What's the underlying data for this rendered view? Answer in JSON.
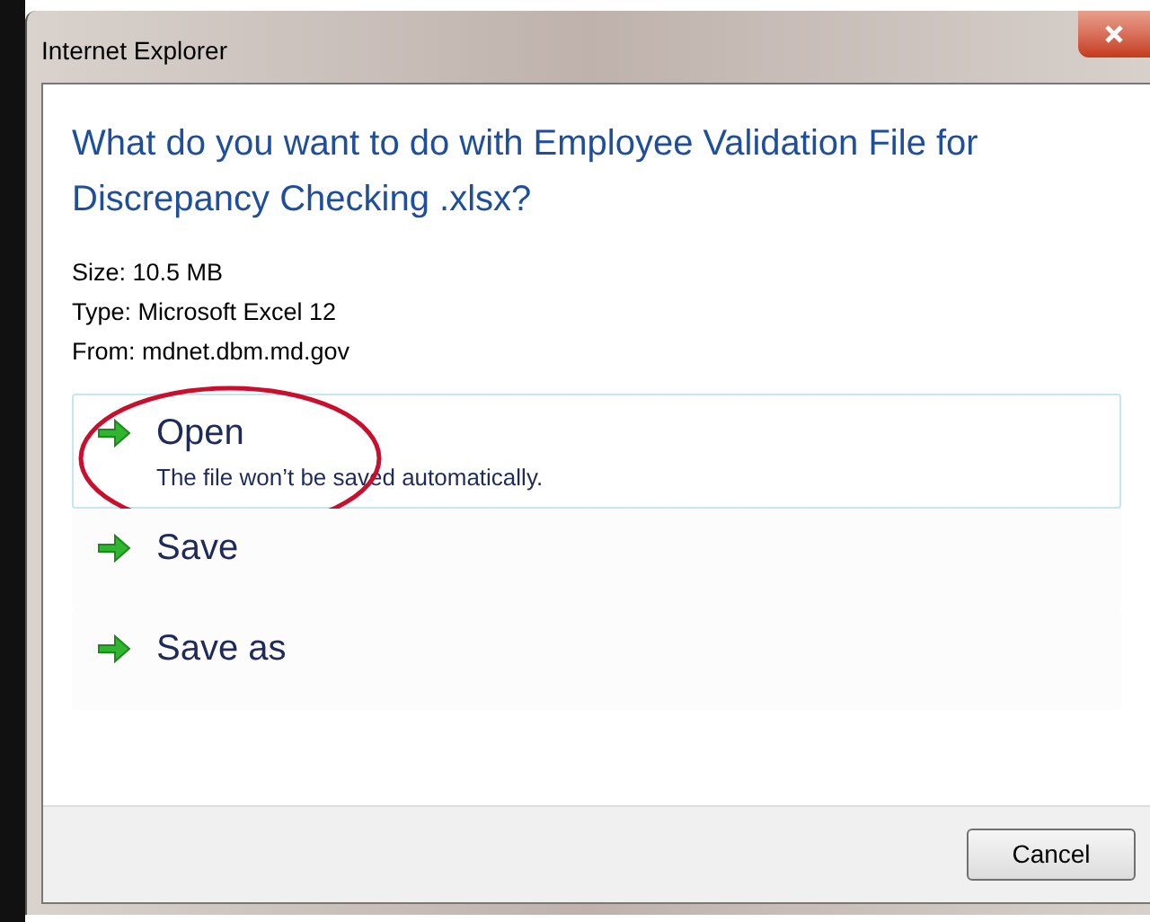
{
  "window": {
    "title": "Internet Explorer"
  },
  "question": "What do you want to do with Employee Validation File for Discrepancy Checking .xlsx?",
  "details": [
    "Size: 10.5 MB",
    "Type: Microsoft Excel 12",
    "From: mdnet.dbm.md.gov"
  ],
  "options": [
    {
      "label": "Open",
      "description": "The file won’t be saved automatically.",
      "selected": true,
      "circled": true
    },
    {
      "label": "Save",
      "selected": false,
      "circled": false
    },
    {
      "label": "Save as",
      "selected": false,
      "circled": false
    }
  ],
  "buttons": [
    "Cancel"
  ]
}
